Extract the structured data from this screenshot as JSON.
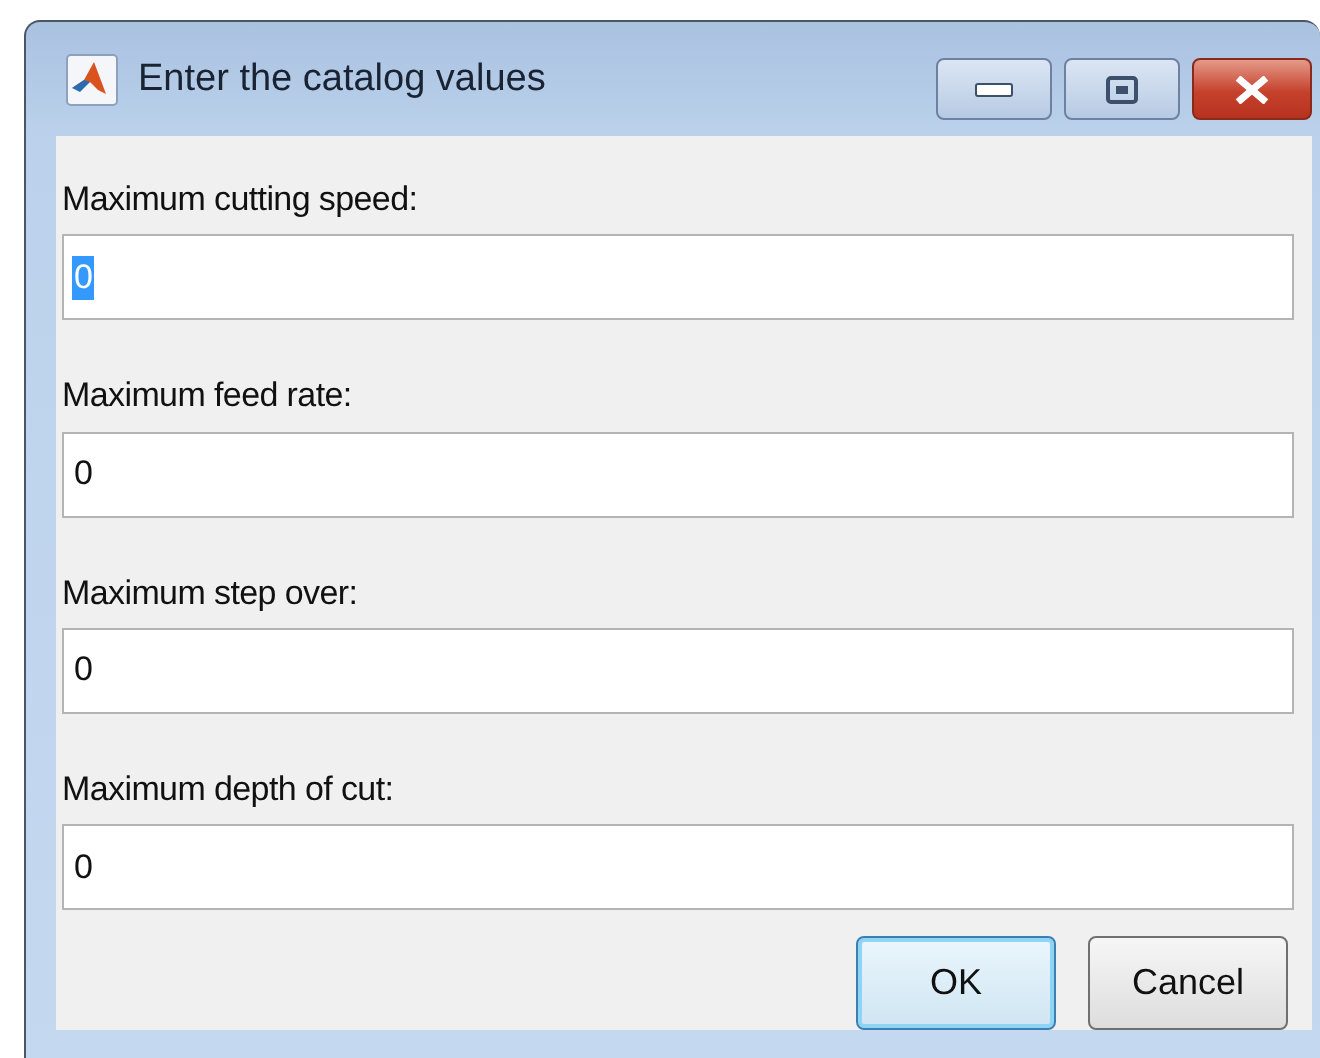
{
  "window": {
    "title": "Enter the catalog values"
  },
  "fields": [
    {
      "label": "Maximum cutting speed:",
      "value": "0",
      "selected": true
    },
    {
      "label": "Maximum feed rate:",
      "value": "0",
      "selected": false
    },
    {
      "label": "Maximum step over:",
      "value": "0",
      "selected": false
    },
    {
      "label": "Maximum depth of cut:",
      "value": "0",
      "selected": false
    }
  ],
  "buttons": [
    {
      "label": "OK",
      "default": true
    },
    {
      "label": "Cancel",
      "default": false
    }
  ]
}
